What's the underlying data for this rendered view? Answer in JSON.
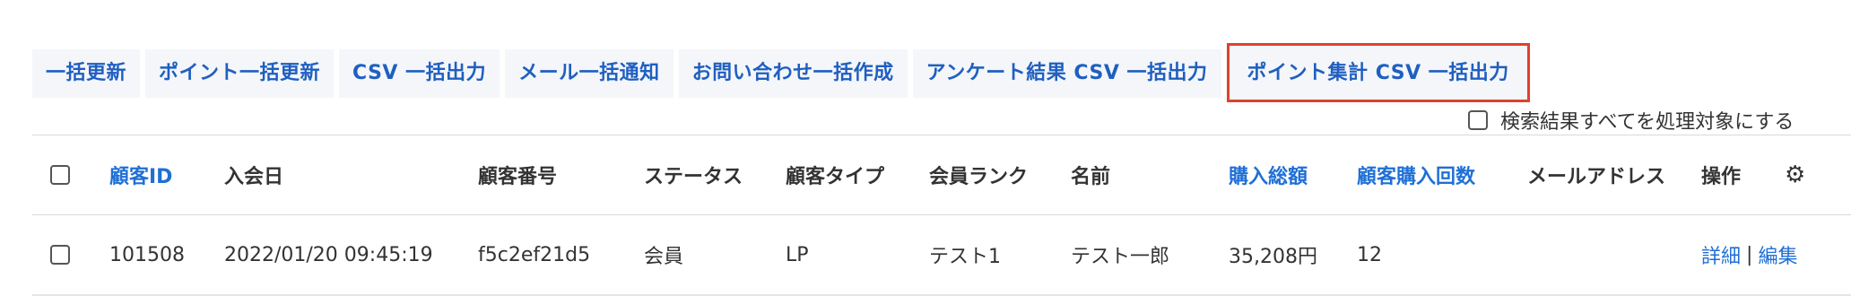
{
  "toolbar": {
    "buttons": [
      "一括更新",
      "ポイント一括更新",
      "CSV 一括出力",
      "メール一括通知",
      "お問い合わせ一括作成",
      "アンケート結果 CSV 一括出力",
      "ポイント集計 CSV 一括出力"
    ],
    "highlighted_index": 6,
    "highlight_color": "#e0412d"
  },
  "bulk_select": {
    "label": "検索結果すべてを処理対象にする",
    "checked": false
  },
  "table": {
    "columns": [
      {
        "label": "顧客ID",
        "sortable": true
      },
      {
        "label": "入会日",
        "sortable": false
      },
      {
        "label": "顧客番号",
        "sortable": false
      },
      {
        "label": "ステータス",
        "sortable": false
      },
      {
        "label": "顧客タイプ",
        "sortable": false
      },
      {
        "label": "会員ランク",
        "sortable": false
      },
      {
        "label": "名前",
        "sortable": false
      },
      {
        "label": "購入総額",
        "sortable": true
      },
      {
        "label": "顧客購入回数",
        "sortable": true
      },
      {
        "label": "メールアドレス",
        "sortable": false
      },
      {
        "label": "操作",
        "sortable": false
      }
    ],
    "settings_icon": "gear-icon",
    "rows": [
      {
        "id": "101508",
        "joined": "2022/01/20 09:45:19",
        "number": "f5c2ef21d5",
        "status": "会員",
        "type": "LP",
        "rank": "テスト1",
        "name": "テスト一郎",
        "total": "35,208円",
        "count": "12",
        "email": "",
        "actions": {
          "detail": "詳細",
          "separator": "|",
          "edit": "編集"
        }
      }
    ]
  },
  "colors": {
    "link": "#1f6fd6",
    "button_bg": "#f4f6f9",
    "border": "#d9d9d9"
  }
}
